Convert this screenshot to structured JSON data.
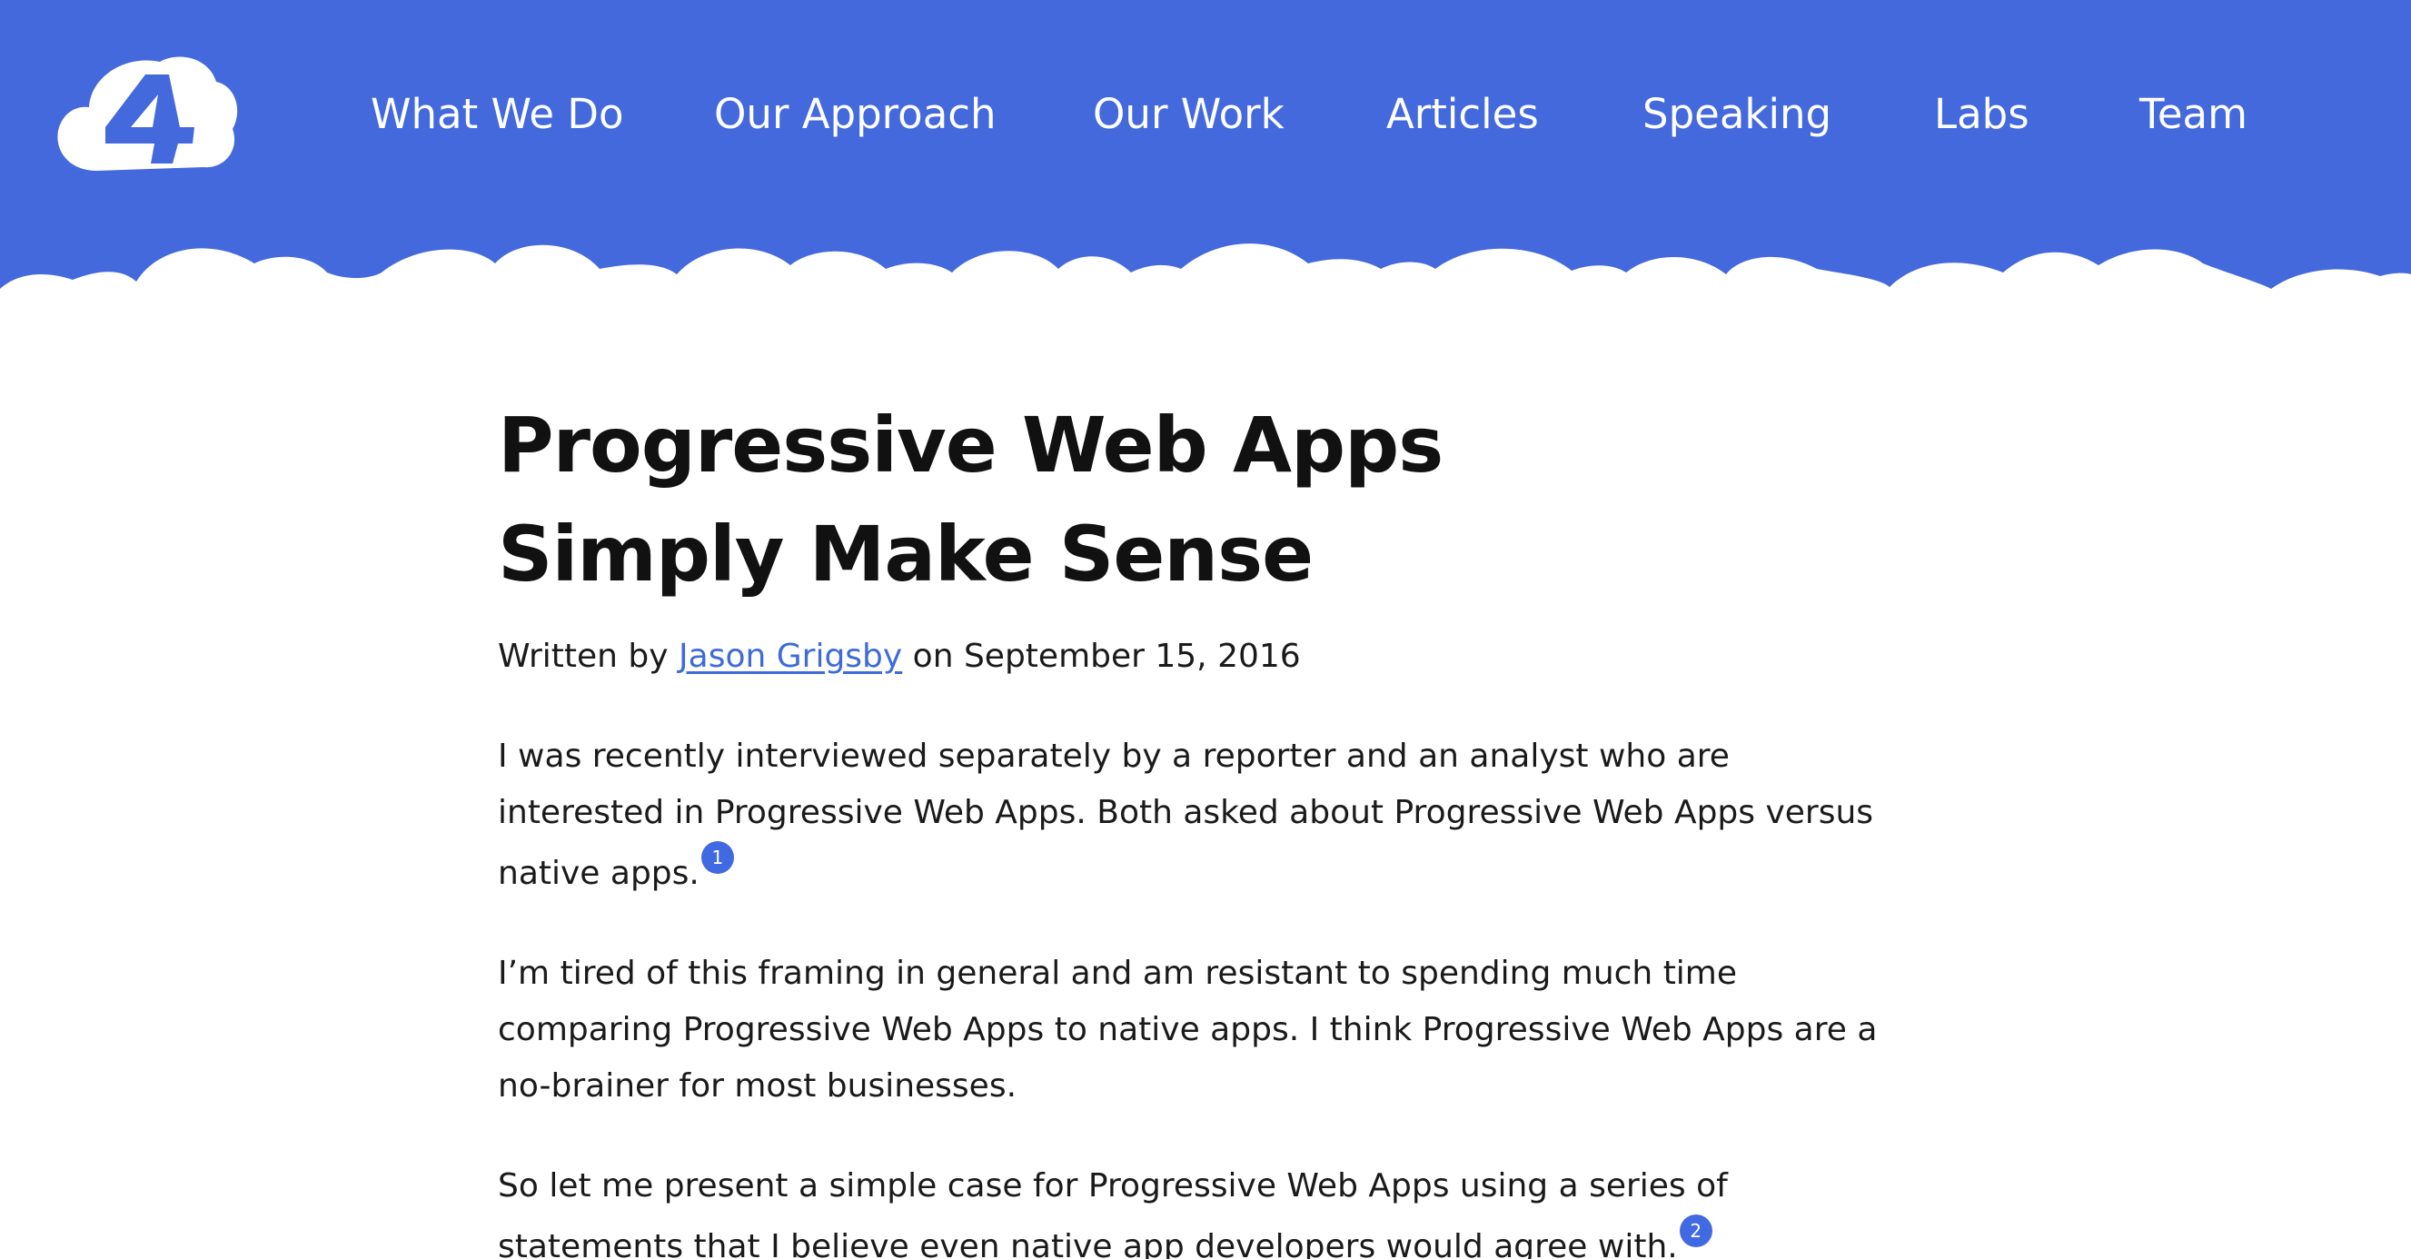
{
  "colors": {
    "header_bg": "#4469dd",
    "accent": "#4169e1",
    "text": "#1a1a1a",
    "link": "#3e6bd8"
  },
  "header": {
    "logo_icon": "cloud-four-logo",
    "nav": [
      {
        "label": "What We Do"
      },
      {
        "label": "Our Approach"
      },
      {
        "label": "Our Work"
      },
      {
        "label": "Articles"
      },
      {
        "label": "Speaking"
      },
      {
        "label": "Labs"
      },
      {
        "label": "Team"
      }
    ]
  },
  "article": {
    "title": "Progressive Web Apps Simply Make Sense",
    "byline": {
      "prefix": "Written by ",
      "author": "Jason Grigsby",
      "suffix": " on September 15, 2016"
    },
    "paragraphs": [
      {
        "text": "I was recently interviewed separately by a reporter and an analyst who are interested in Progressive Web Apps. Both asked about Progressive Web Apps versus native apps.",
        "footnote": "1"
      },
      {
        "text": "I’m tired of this framing in general and am resistant to spending much time comparing Progressive Web Apps to native apps. I think Progressive Web Apps are a no-brainer for most businesses.",
        "footnote": ""
      },
      {
        "text": "So let me present a simple case for Progressive Web Apps using a series of statements that I believe even native app developers would agree with.",
        "footnote": "2"
      }
    ]
  }
}
